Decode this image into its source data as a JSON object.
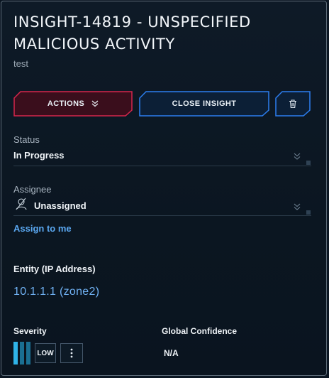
{
  "insight": {
    "title": "INSIGHT-14819 - UNSPECIFIED MALICIOUS ACTIVITY",
    "subtitle": "test"
  },
  "toolbar": {
    "actions_label": "ACTIONS",
    "close_label": "CLOSE INSIGHT",
    "trash_icon": "trash-icon"
  },
  "status": {
    "label": "Status",
    "value": "In Progress"
  },
  "assignee": {
    "label": "Assignee",
    "value": "Unassigned",
    "assign_link": "Assign to me"
  },
  "entity": {
    "label": "Entity (IP Address)",
    "value": "10.1.1.1 (zone2)"
  },
  "severity": {
    "label": "Severity",
    "value": "LOW",
    "bar_colors": [
      "#2fb3e8",
      "#1a6f92",
      "#1a6f92"
    ]
  },
  "confidence": {
    "label": "Global Confidence",
    "value": "N/A"
  },
  "colors": {
    "actions_border": "#d6264c",
    "close_border": "#2c7ef0",
    "link": "#5aa7f0"
  }
}
